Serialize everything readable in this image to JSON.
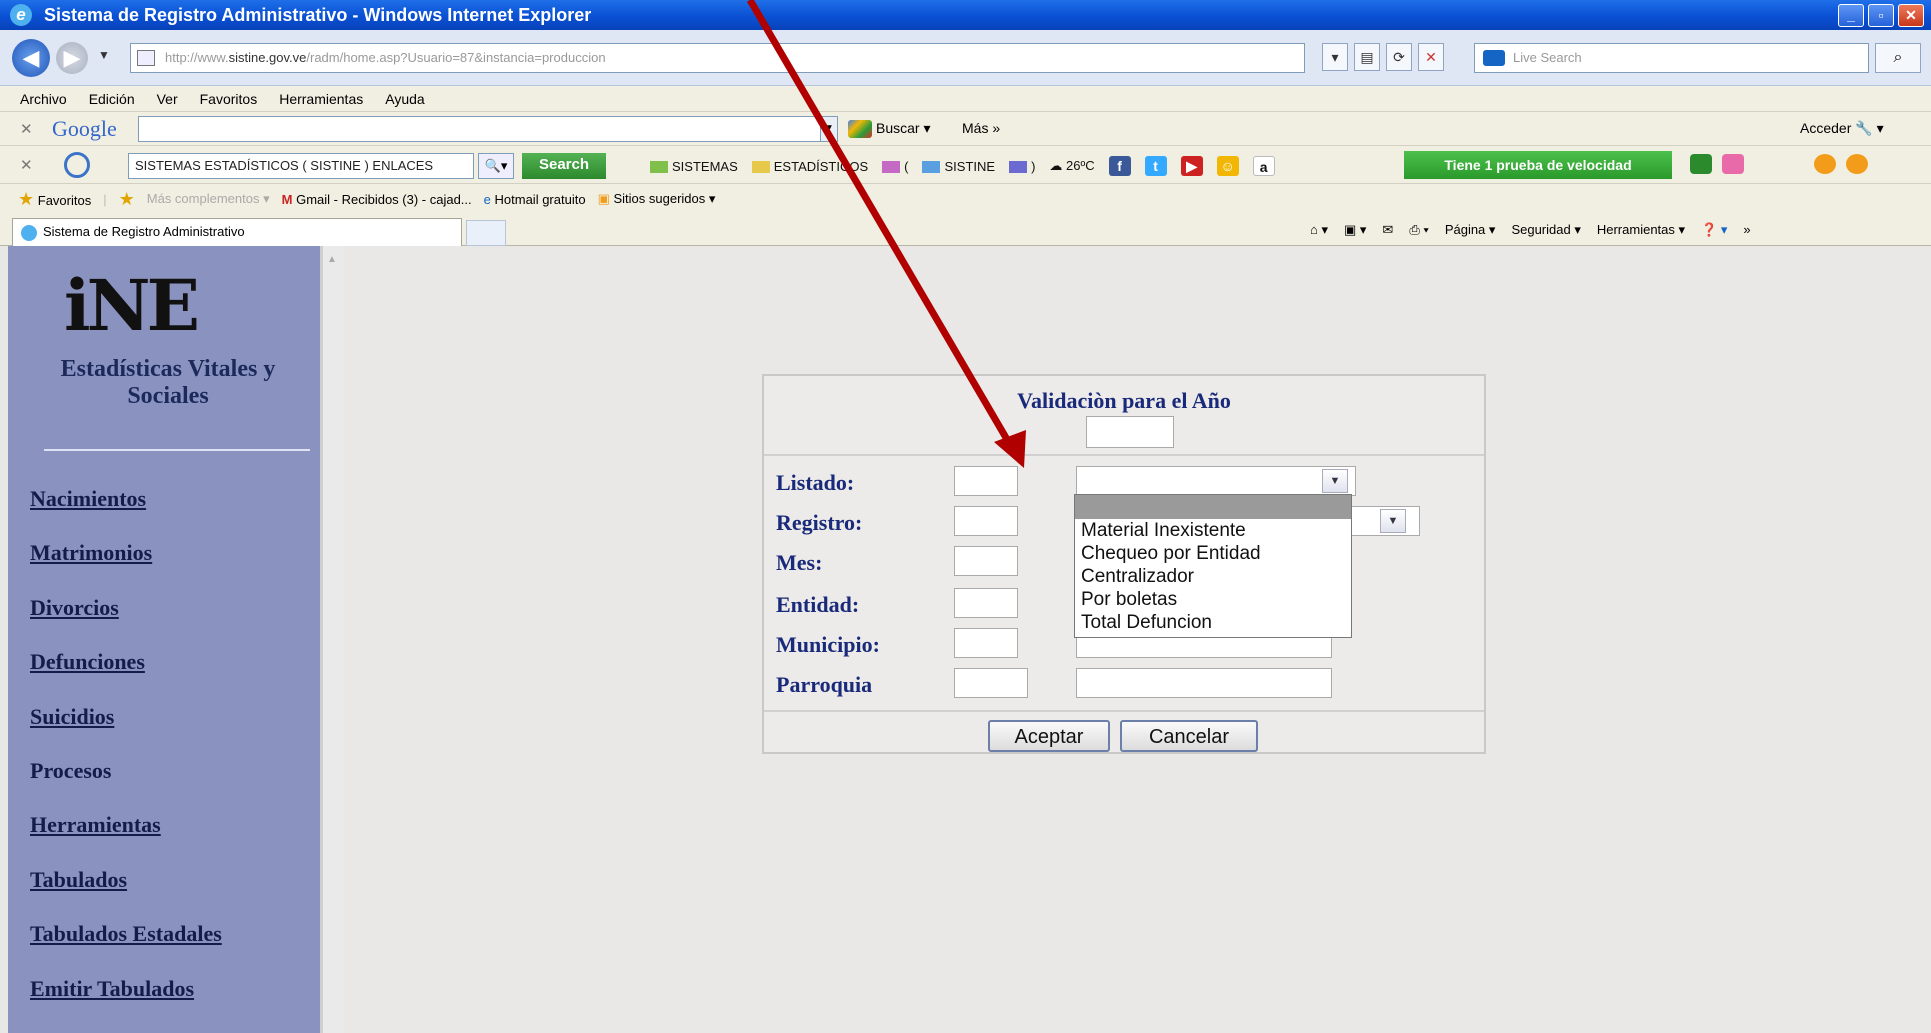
{
  "window": {
    "title": "Sistema de Registro Administrativo - Windows Internet Explorer",
    "min": "_",
    "max": "▫",
    "close": "✕"
  },
  "address": {
    "url_prefix": "http://www.",
    "url_host": "sistine.gov.ve",
    "url_path": "/radm/home.asp?Usuario=87&instancia=produccion",
    "live_search": "Live Search"
  },
  "menu": [
    "Archivo",
    "Edición",
    "Ver",
    "Favoritos",
    "Herramientas",
    "Ayuda"
  ],
  "google_bar": {
    "logo": "Google",
    "buscar": "Buscar",
    "mas": "Más »",
    "acceder": "Acceder"
  },
  "sistine_bar": {
    "query": "SISTEMAS ESTADÍSTICOS ( SISTINE ) ENLACES",
    "search": "Search",
    "links": [
      "SISTEMAS",
      "ESTADÍSTICOS",
      "(",
      "SISTINE",
      ")"
    ],
    "temp": "26ºC",
    "speed": "Tiene 1 prueba de velocidad"
  },
  "favorites": {
    "label": "Favoritos",
    "items": [
      "Más complementos",
      "Gmail - Recibidos (3) - cajad...",
      "Hotmail gratuito",
      "Sitios sugeridos"
    ]
  },
  "tab": {
    "title": "Sistema de Registro Administrativo"
  },
  "command_bar": [
    "Página",
    "Seguridad",
    "Herramientas"
  ],
  "sidebar": {
    "logo": "iNE",
    "org": "Estadísticas Vitales y Sociales",
    "items": [
      "Nacimientos",
      "Matrimonios",
      "Divorcios",
      "Defunciones",
      "Suicidios",
      "Procesos",
      "Herramientas",
      "Tabulados",
      "Tabulados Estadales",
      "Emitir Tabulados"
    ]
  },
  "form": {
    "title": "Validaciòn para el Año",
    "labels": [
      "Listado:",
      "Registro:",
      "Mes:",
      "Entidad:",
      "Municipio:",
      "Parroquia"
    ],
    "accept": "Aceptar",
    "cancel": "Cancelar",
    "dropdown_options": [
      "Material Inexistente",
      "Chequeo por Entidad",
      "Centralizador",
      "Por boletas",
      "Total Defuncion"
    ]
  },
  "colors": {
    "sidebar": "#8a92bf",
    "arrow": "#b00000",
    "form_label": "#1a2a7a"
  }
}
